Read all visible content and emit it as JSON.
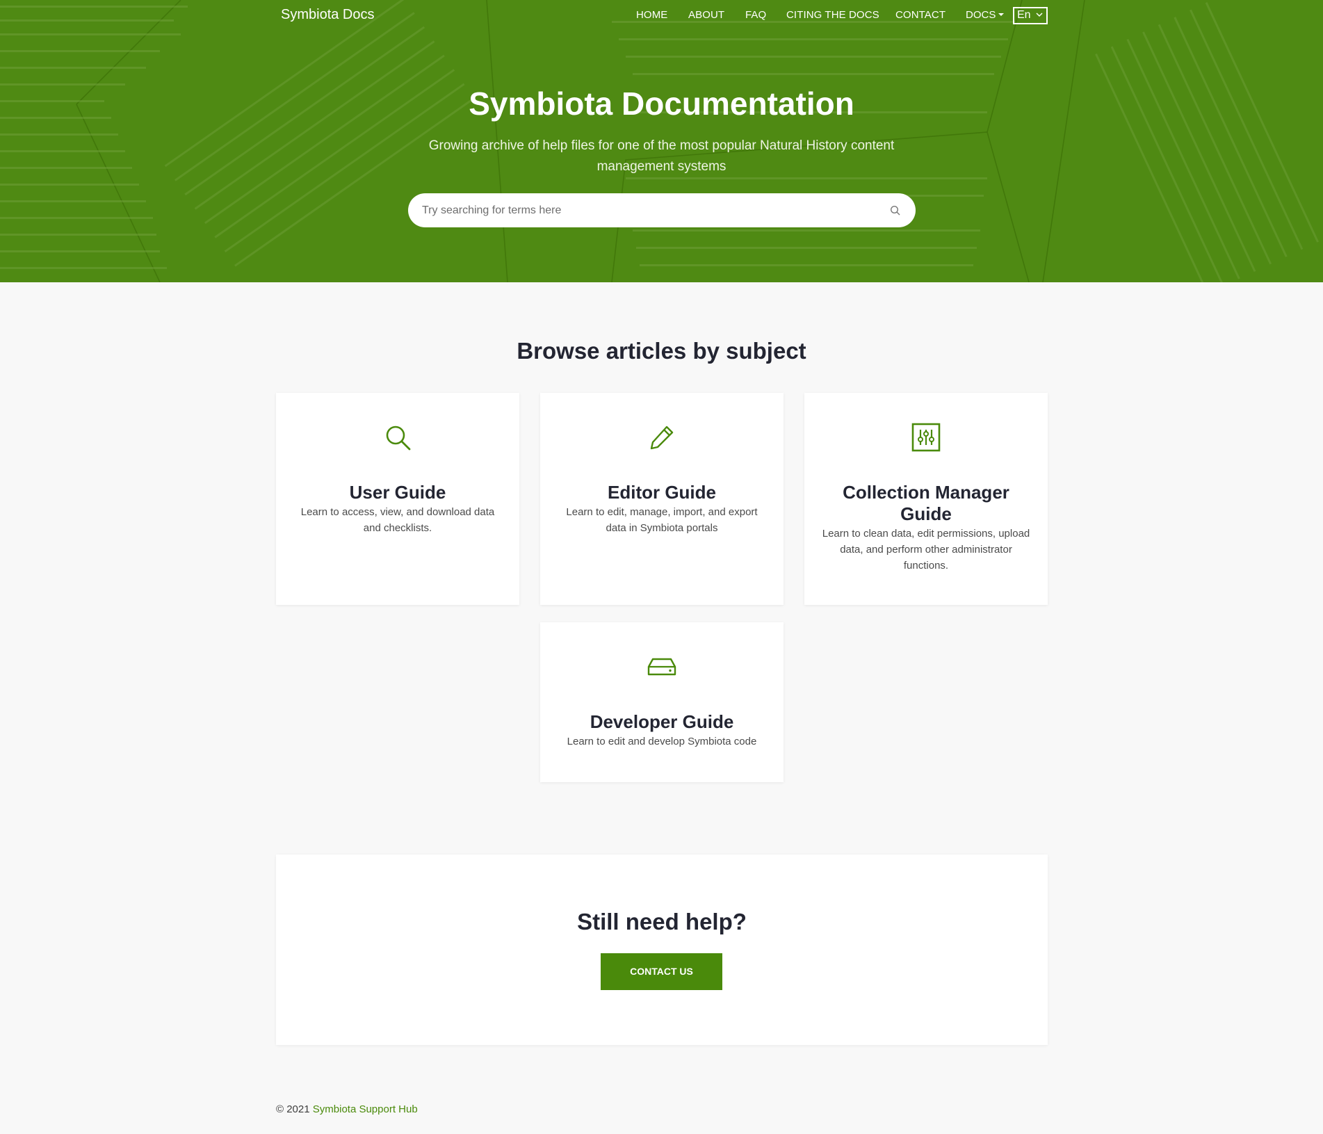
{
  "navbar": {
    "brand": "Symbiota Docs",
    "links": [
      "HOME",
      "ABOUT",
      "FAQ",
      "CITING THE DOCS",
      "CONTACT"
    ],
    "docs_label": "DOCS",
    "language": "En"
  },
  "hero": {
    "title": "Symbiota Documentation",
    "subtitle": "Growing archive of help files for one of the most popular Natural History content management systems",
    "search_placeholder": "Try searching for terms here"
  },
  "browse": {
    "title": "Browse articles by subject",
    "cards": [
      {
        "icon": "search-icon",
        "title": "User Guide",
        "description": "Learn to access, view, and download data and checklists."
      },
      {
        "icon": "pencil-icon",
        "title": "Editor Guide",
        "description": "Learn to edit, manage, import, and export data in Symbiota portals"
      },
      {
        "icon": "sliders-icon",
        "title": "Collection Manager Guide",
        "description": "Learn to clean data, edit permissions, upload data, and perform other administrator functions."
      },
      {
        "icon": "hard-drive-icon",
        "title": "Developer Guide",
        "description": "Learn to edit and develop Symbiota code"
      }
    ]
  },
  "help": {
    "title": "Still need help?",
    "button": "CONTACT US"
  },
  "footer": {
    "copyright": "© 2021",
    "link": "Symbiota Support Hub"
  },
  "colors": {
    "hero_green": "#4f8a13",
    "accent_green": "#4a8a0b",
    "page_background": "#f8f8f8",
    "heading_text": "#232532"
  }
}
